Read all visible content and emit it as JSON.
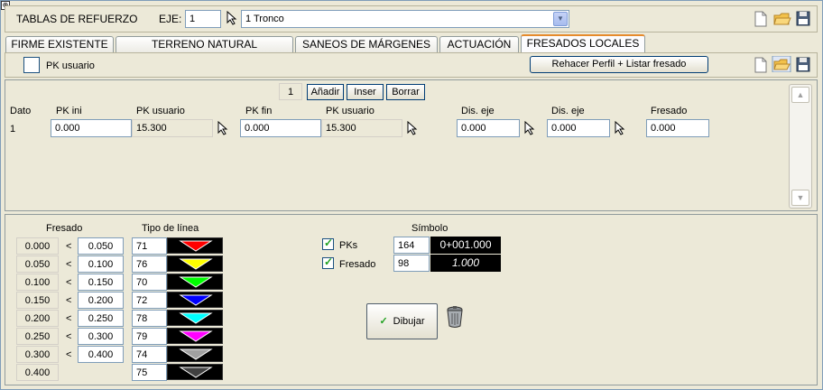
{
  "header": {
    "title": "TABLAS DE REFUERZO",
    "eje_label": "EJE:",
    "eje_value": "1",
    "eje_select": "1 Tronco"
  },
  "tabs": [
    {
      "label": "FIRME EXISTENTE"
    },
    {
      "label": "TERRENO NATURAL RECONOCIDO"
    },
    {
      "label": "SANEOS DE MÁRGENES"
    },
    {
      "label": "ACTUACIÓN"
    },
    {
      "label": "FRESADOS LOCALES"
    }
  ],
  "toolbar": {
    "pk_usuario_label": "PK usuario",
    "rehacer_label": "Rehacer Perfil + Listar fresado"
  },
  "grid": {
    "counter": "1",
    "add_label": "Añadir",
    "insert_label": "Inser",
    "delete_label": "Borrar",
    "headers": [
      "Dato",
      "PK ini",
      "PK usuario",
      "PK fin",
      "PK usuario",
      "Dis. eje",
      "Dis. eje",
      "Fresado"
    ],
    "row": {
      "dato": "1",
      "pk_ini": "0.000",
      "pk_usuario_1": "15.300",
      "pk_fin": "0.000",
      "pk_usuario_2": "15.300",
      "dis_eje_1": "0.000",
      "dis_eje_2": "0.000",
      "fresado": "0.000"
    }
  },
  "legend": {
    "fresado_header": "Fresado",
    "tipo_header": "Tipo de línea",
    "lt": "<",
    "rows": [
      {
        "from": "0.000",
        "to": "0.050",
        "type": "71",
        "color": "#ff0000"
      },
      {
        "from": "0.050",
        "to": "0.100",
        "type": "76",
        "color": "#ffff00"
      },
      {
        "from": "0.100",
        "to": "0.150",
        "type": "70",
        "color": "#00ff00"
      },
      {
        "from": "0.150",
        "to": "0.200",
        "type": "72",
        "color": "#0000ff"
      },
      {
        "from": "0.200",
        "to": "0.250",
        "type": "78",
        "color": "#00ffff"
      },
      {
        "from": "0.250",
        "to": "0.300",
        "type": "79",
        "color": "#ff00ff"
      },
      {
        "from": "0.300",
        "to": "0.400",
        "type": "74",
        "color": "#a0a0a0"
      },
      {
        "from": "0.400",
        "to": "",
        "type": "75",
        "color": "#404040"
      }
    ]
  },
  "symbol": {
    "header": "Símbolo",
    "pks_label": "PKs",
    "pks_value": "164",
    "pks_sample": "0+001.000",
    "fresado_label": "Fresado",
    "fresado_value": "98",
    "fresado_sample": "1.000"
  },
  "draw_button": "Dibujar"
}
